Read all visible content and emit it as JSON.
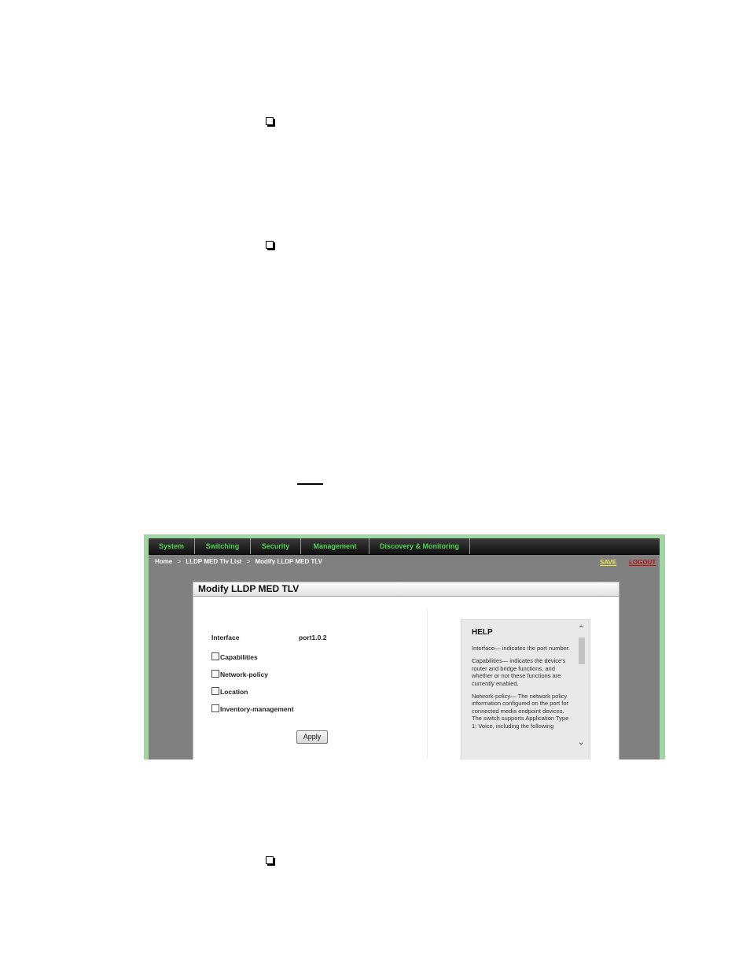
{
  "document": {
    "bullets": [
      {
        "icon": "square-bullet-icon"
      },
      {
        "icon": "square-bullet-icon"
      },
      {
        "icon": "square-bullet-icon"
      }
    ]
  },
  "screenshot": {
    "nav": {
      "items": [
        "System",
        "Switching",
        "Security",
        "Management",
        "Discovery & Monitoring"
      ]
    },
    "breadcrumb": {
      "items": [
        "Home",
        "LLDP MED Tlv List",
        "Modify LLDP MED TLV"
      ],
      "separator": ">"
    },
    "links": {
      "save": "SAVE",
      "logout": "LOGOUT"
    },
    "panel": {
      "title": "Modify LLDP MED TLV",
      "interface_label": "Interface",
      "interface_value": "port1.0.2",
      "checkboxes": [
        {
          "label": "Capabilities",
          "checked": false
        },
        {
          "label": "Network-policy",
          "checked": false
        },
        {
          "label": "Location",
          "checked": false
        },
        {
          "label": "Inventory-management",
          "checked": false
        }
      ],
      "apply_label": "Apply"
    },
    "help": {
      "title": "HELP",
      "paragraphs": [
        "Interface— indicates the port number.",
        "Capabilities— indicates the device's router and bridge functions, and whether or not these functions are currently enabled.",
        "Network-policy— The network policy information configured on the port for connected media endpoint devices. The switch supports Application Type 1: Voice, including the following"
      ]
    },
    "colors": {
      "nav_text": "#4fd04f",
      "save_link": "#e8e84a",
      "logout_link": "#c01010",
      "frame_border": "#a3d4a3"
    }
  }
}
